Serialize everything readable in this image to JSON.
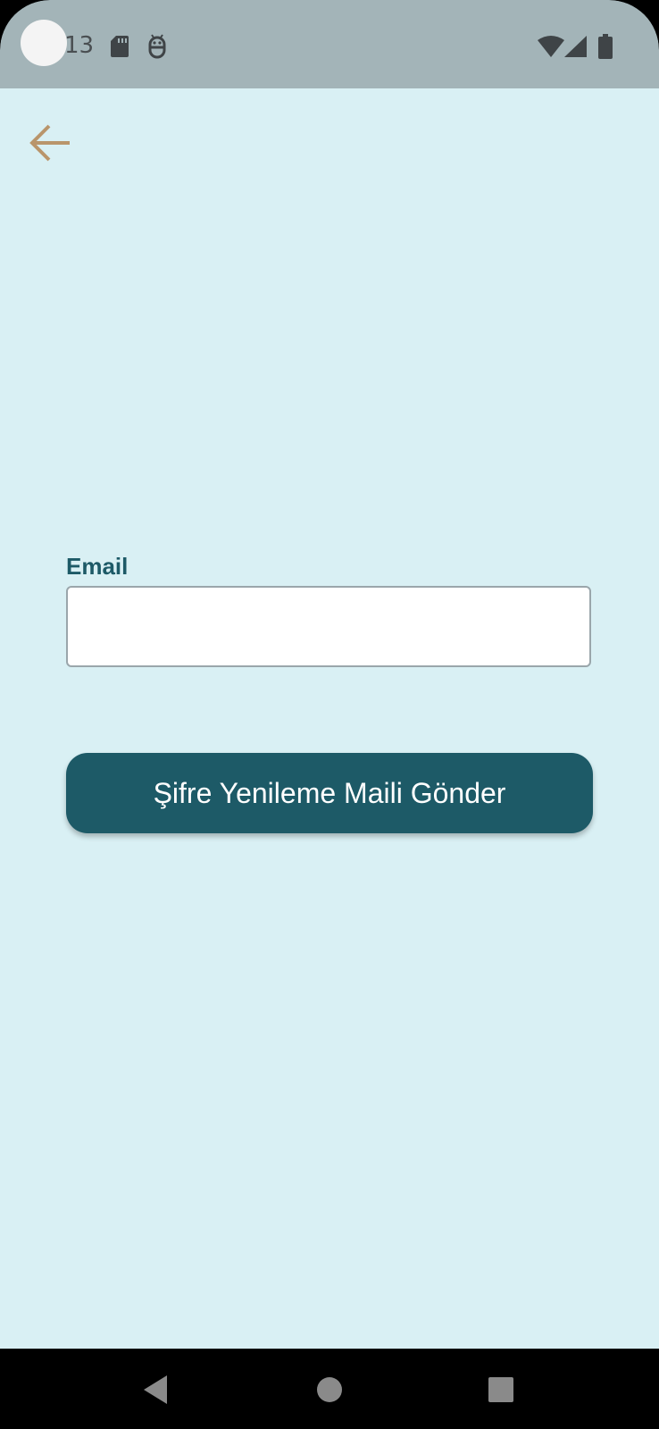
{
  "status_bar": {
    "time": "13",
    "icons": [
      "sd-card-icon",
      "android-debug-icon",
      "wifi-icon",
      "cell-signal-icon",
      "battery-icon"
    ],
    "background_color": "#a3b4b8"
  },
  "header": {
    "back_icon": "arrow-left-icon",
    "back_icon_color": "#b9956b"
  },
  "form": {
    "email_label": "Email",
    "email_value": "",
    "email_placeholder": "",
    "submit_label": "Şifre Yenileme Maili Gönder"
  },
  "nav_bar": {
    "icons": [
      "back-triangle-icon",
      "home-circle-icon",
      "recents-square-icon"
    ]
  },
  "colors": {
    "background": "#d9f0f4",
    "primary": "#1d5a67",
    "accent": "#b9956b"
  }
}
